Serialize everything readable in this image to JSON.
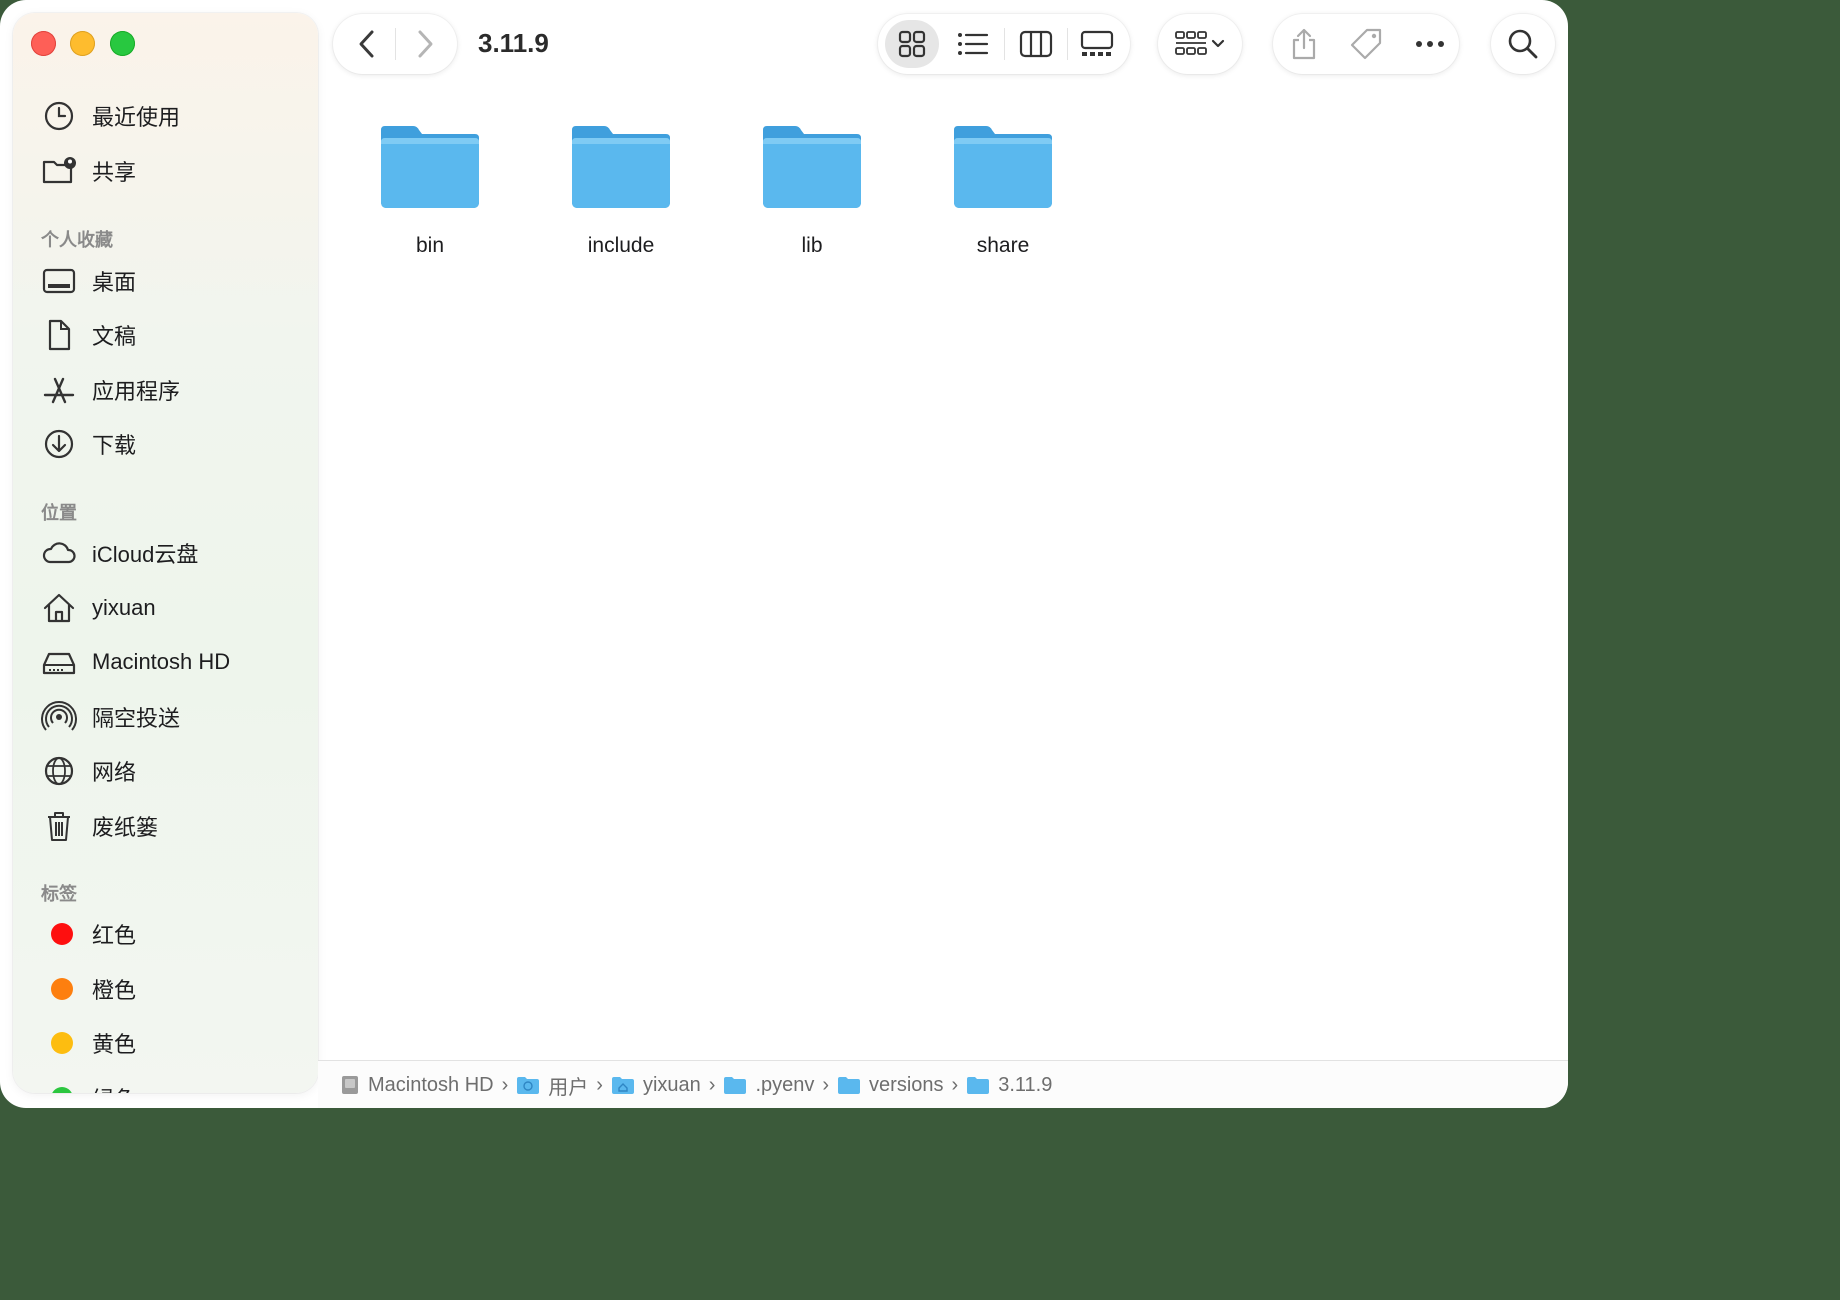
{
  "window": {
    "title": "3.11.9"
  },
  "sidebar": {
    "top_items": [
      {
        "label": "最近使用",
        "icon": "clock-icon"
      },
      {
        "label": "共享",
        "icon": "shared-folder-icon"
      }
    ],
    "favorites_header": "个人收藏",
    "favorites": [
      {
        "label": "桌面",
        "icon": "desktop-icon"
      },
      {
        "label": "文稿",
        "icon": "document-icon"
      },
      {
        "label": "应用程序",
        "icon": "applications-icon"
      },
      {
        "label": "下载",
        "icon": "download-icon"
      }
    ],
    "locations_header": "位置",
    "locations": [
      {
        "label": "iCloud云盘",
        "icon": "cloud-icon"
      },
      {
        "label": "yixuan",
        "icon": "home-icon"
      },
      {
        "label": "Macintosh HD",
        "icon": "harddrive-icon"
      },
      {
        "label": "隔空投送",
        "icon": "airdrop-icon"
      },
      {
        "label": "网络",
        "icon": "globe-icon"
      },
      {
        "label": "废纸篓",
        "icon": "trash-icon"
      }
    ],
    "tags_header": "标签",
    "tags": [
      {
        "label": "红色",
        "color": "#fe0f0f"
      },
      {
        "label": "橙色",
        "color": "#fd7f0f"
      },
      {
        "label": "黄色",
        "color": "#fdbd10"
      },
      {
        "label": "绿色",
        "color": "#2bc63f"
      }
    ]
  },
  "toolbar": {
    "back_icon": "chevron-left-icon",
    "forward_icon": "chevron-right-icon",
    "view_modes": [
      "icon-view",
      "list-view",
      "column-view",
      "gallery-view"
    ],
    "active_view": "icon-view",
    "group_icon": "group-by-icon",
    "share_icon": "share-icon",
    "tag_icon": "tag-icon",
    "more_icon": "ellipsis-icon",
    "search_icon": "search-icon"
  },
  "content": {
    "folders": [
      {
        "name": "bin"
      },
      {
        "name": "include"
      },
      {
        "name": "lib"
      },
      {
        "name": "share"
      }
    ]
  },
  "pathbar": {
    "crumbs": [
      "Macintosh HD",
      "用户",
      "yixuan",
      ".pyenv",
      "versions",
      "3.11.9"
    ]
  },
  "colors": {
    "folder": "#5ab8ee",
    "accent": "#1e9be8"
  }
}
